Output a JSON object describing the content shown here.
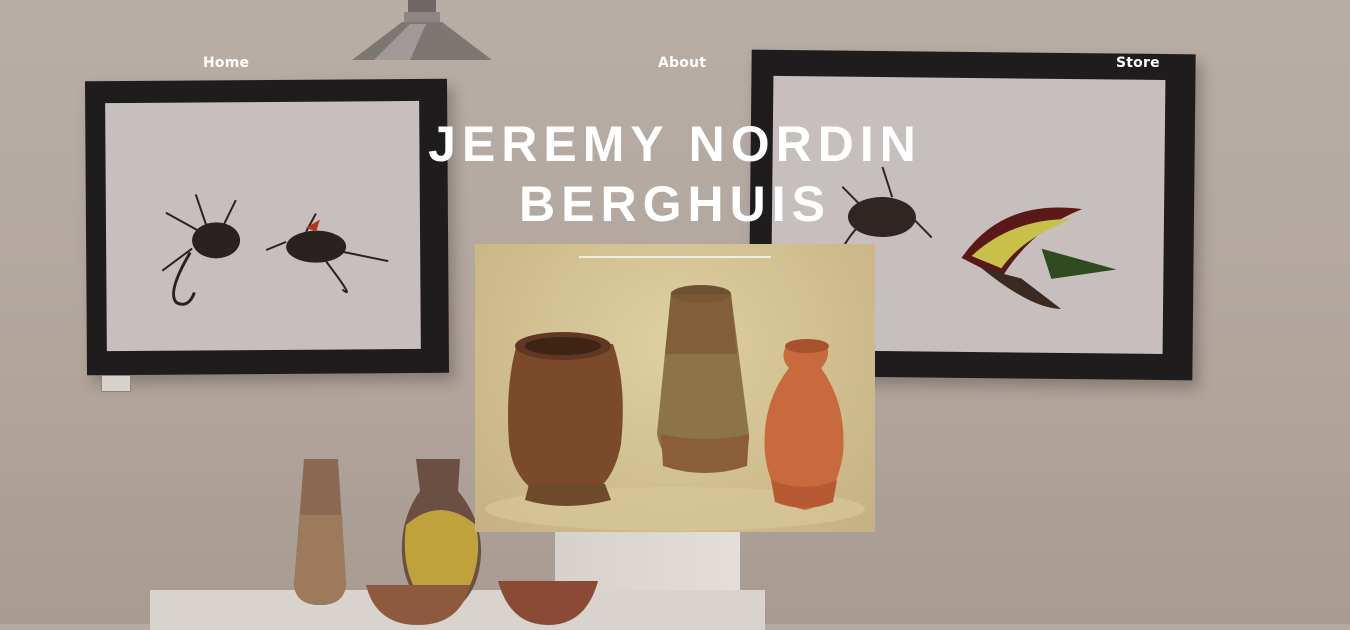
{
  "nav": {
    "home": "Home",
    "about": "About",
    "store": "Store"
  },
  "hero": {
    "title_line1": "JEREMY NORDIN",
    "title_line2": "BERGHUIS"
  },
  "colors": {
    "nav_text": "#ffffff",
    "title_text": "#ffffff",
    "background": "#b5aaa2"
  }
}
